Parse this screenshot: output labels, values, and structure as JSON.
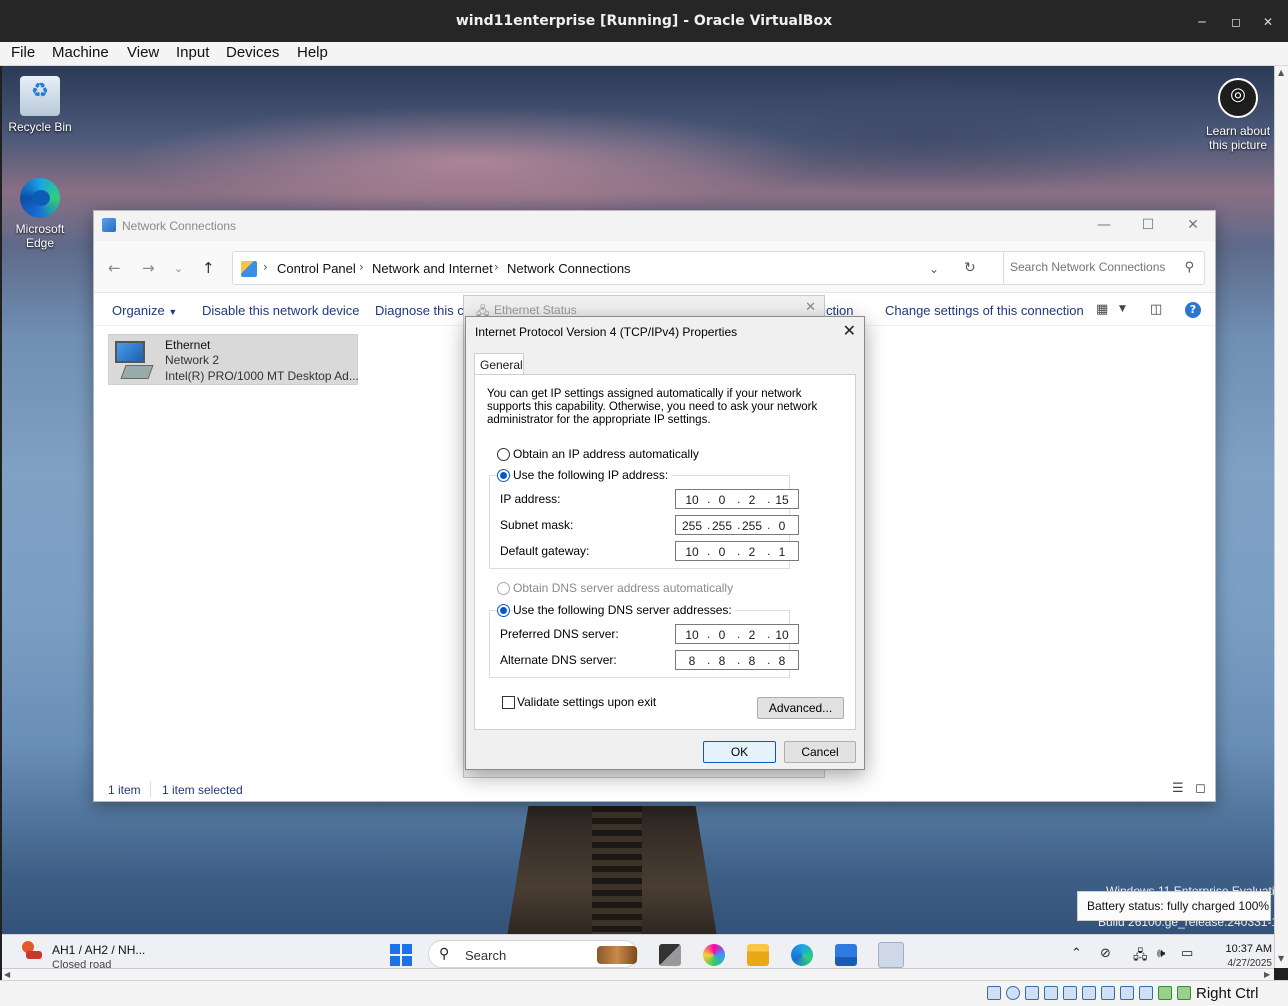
{
  "host": {
    "title": "wind11enterprise [Running] - Oracle VirtualBox",
    "menu": [
      "File",
      "Machine",
      "View",
      "Input",
      "Devices",
      "Help"
    ],
    "host_key": "Right Ctrl"
  },
  "desktop": {
    "icons": [
      {
        "label": "Recycle Bin",
        "icon": "recycle-bin-icon"
      },
      {
        "label": "Microsoft Edge",
        "icon": "edge-icon"
      }
    ],
    "learn_line1": "Learn about",
    "learn_line2": "this picture",
    "watermark_line1": "Windows 11 Enterprise Evaluation",
    "watermark_line2": "Build 26100.ge_release.240331-1435"
  },
  "network_window": {
    "title": "Network Connections",
    "breadcrumb": [
      "Control Panel",
      "Network and Internet",
      "Network Connections"
    ],
    "search_placeholder": "Search Network Connections",
    "toolbar": {
      "organize": "Organize",
      "disable": "Disable this network device",
      "diagnose": "Diagnose this co",
      "rename_tail": "ction",
      "change": "Change settings of this connection"
    },
    "item": {
      "name": "Ethernet",
      "network": "Network 2",
      "adapter": "Intel(R) PRO/1000 MT Desktop Ad..."
    },
    "status": {
      "count": "1 item",
      "selected": "1 item selected"
    }
  },
  "ethernet_status": {
    "title": "Ethernet Status"
  },
  "ipv4_dialog": {
    "title": "Internet Protocol Version 4 (TCP/IPv4) Properties",
    "tab": "General",
    "description": "You can get IP settings assigned automatically if your network supports this capability. Otherwise, you need to ask your network administrator for the appropriate IP settings.",
    "obtain_ip_auto": "Obtain an IP address automatically",
    "use_following_ip": "Use the following IP address:",
    "ip_label": "IP address:",
    "ip_value": [
      "10",
      "0",
      "2",
      "15"
    ],
    "subnet_label": "Subnet mask:",
    "subnet_value": [
      "255",
      "255",
      "255",
      "0"
    ],
    "gateway_label": "Default gateway:",
    "gateway_value": [
      "10",
      "0",
      "2",
      "1"
    ],
    "obtain_dns_auto": "Obtain DNS server address automatically",
    "use_following_dns": "Use the following DNS server addresses:",
    "preferred_dns_label": "Preferred DNS server:",
    "preferred_dns_value": [
      "10",
      "0",
      "2",
      "10"
    ],
    "alternate_dns_label": "Alternate DNS server:",
    "alternate_dns_value": [
      "8",
      "8",
      "8",
      "8"
    ],
    "validate_label": "Validate settings upon exit",
    "validate_checked": false,
    "advanced_label": "Advanced...",
    "ok_label": "OK",
    "cancel_label": "Cancel"
  },
  "taskbar": {
    "weather_line1": "AH1 / AH2 / NH...",
    "weather_line2": "Closed road",
    "search_label": "Search",
    "time": "10:37 AM",
    "date": "4/27/2025",
    "battery_tooltip": "Battery status: fully charged 100%"
  },
  "colors": {
    "accent": "#0a58c8",
    "link": "#1f3a7a",
    "host_titlebar": "#262626"
  }
}
